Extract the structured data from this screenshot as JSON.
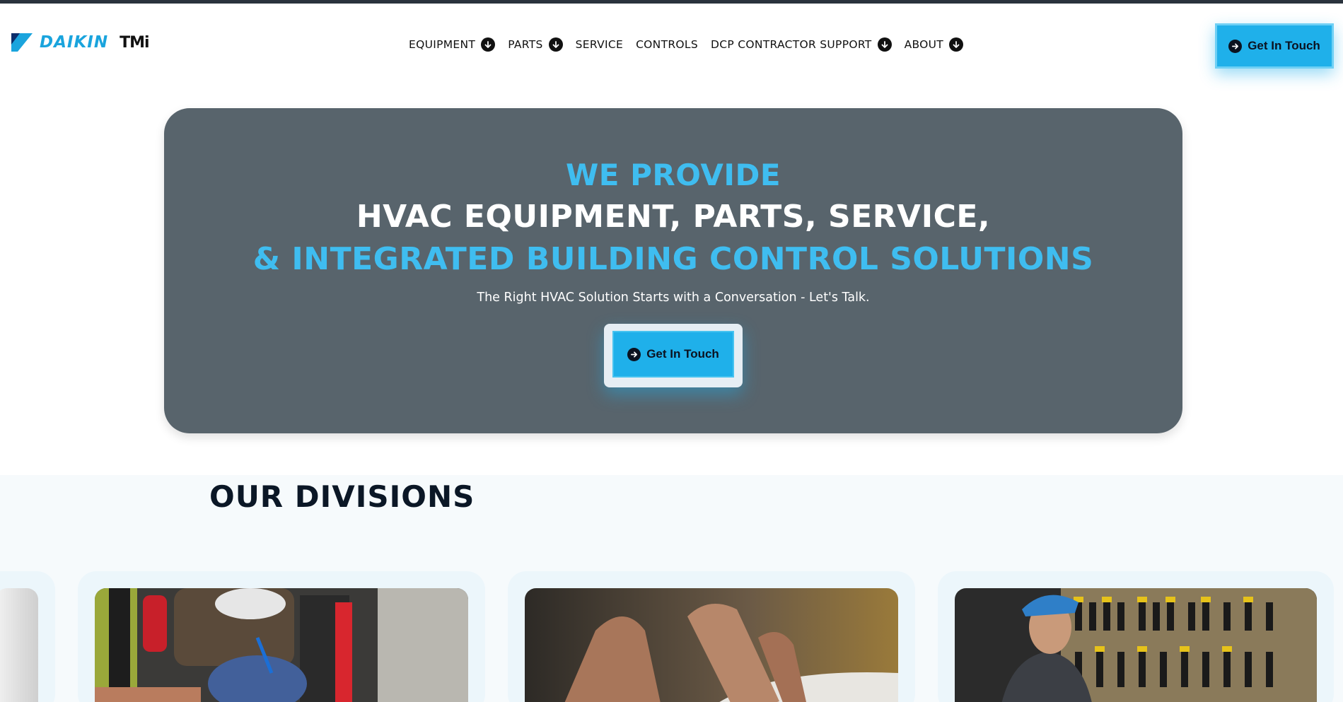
{
  "header": {
    "logo_text": "DAIKIN",
    "logo_suffix": "TMi",
    "nav": [
      {
        "label": "EQUIPMENT",
        "has_dropdown": true
      },
      {
        "label": "PARTS",
        "has_dropdown": true
      },
      {
        "label": "SERVICE",
        "has_dropdown": false
      },
      {
        "label": "CONTROLS",
        "has_dropdown": false
      },
      {
        "label": "DCP CONTRACTOR SUPPORT",
        "has_dropdown": true
      },
      {
        "label": "ABOUT",
        "has_dropdown": true
      }
    ],
    "cta_label": "Get In Touch"
  },
  "hero": {
    "line1": "WE PROVIDE",
    "line2": "HVAC EQUIPMENT, PARTS, SERVICE,",
    "line3": "& INTEGRATED BUILDING CONTROL SOLUTIONS",
    "subtitle": "The Right HVAC Solution Starts with a Conversation - Let's Talk.",
    "cta_label": "Get In Touch"
  },
  "divisions": {
    "title": "OUR DIVISIONS"
  },
  "colors": {
    "accent": "#1fb0ea",
    "hero_bg": "#58646c",
    "highlight_text": "#3fbdf0",
    "dark": "#0b1220"
  },
  "icons": {
    "dropdown": "chevron-down-circle-icon",
    "cta": "arrow-right-circle-icon"
  }
}
